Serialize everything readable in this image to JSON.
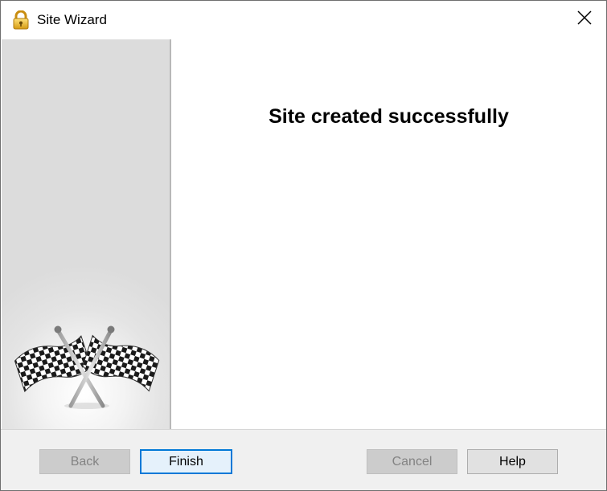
{
  "window": {
    "title": "Site Wizard",
    "title_icon": "padlock-icon",
    "close_icon": "close-icon"
  },
  "side_panel": {
    "image": "checkered-flags-icon"
  },
  "content": {
    "heading": "Site created successfully"
  },
  "footer": {
    "back_label": "Back",
    "finish_label": "Finish",
    "cancel_label": "Cancel",
    "help_label": "Help"
  },
  "colors": {
    "default_button_border": "#0078d7",
    "disabled_text": "#838383",
    "footer_bg": "#f0f0f0"
  }
}
